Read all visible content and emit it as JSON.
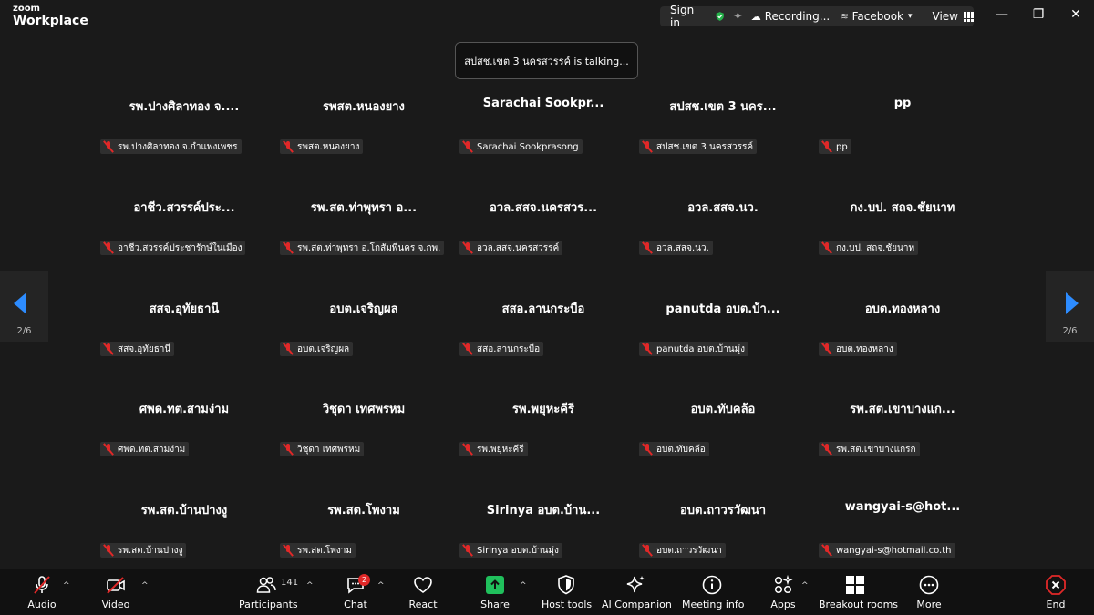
{
  "app": {
    "logo_line1": "zoom",
    "logo_line2": "Workplace"
  },
  "topbar": {
    "sign_in": "Sign in",
    "recording": "Recording...",
    "stream": "Facebook",
    "view": "View",
    "icons": [
      "shield-check-icon",
      "sparkle-icon",
      "cloud-icon",
      "wifi-icon",
      "grid-icon",
      "minimize-icon",
      "restore-icon",
      "close-icon"
    ]
  },
  "toast": "สปสช.เขต 3 นครสวรรค์ is talking...",
  "tiles": [
    {
      "big": "รพ.ปางศิลาทอง จ....",
      "tag": "รพ.ปางศิลาทอง จ.กำแพงเพชร"
    },
    {
      "big": "รพสต.หนองยาง",
      "tag": "รพสต.หนองยาง"
    },
    {
      "big": "Sarachai  Sookpr...",
      "tag": "Sarachai Sookprasong"
    },
    {
      "big": "สปสช.เขต 3 นคร...",
      "tag": "สปสช.เขต 3 นครสวรรค์"
    },
    {
      "big": "pp",
      "tag": "pp"
    },
    {
      "big": "อาชีว.สวรรค์ประ...",
      "tag": "อาชีว.สวรรค์ประชารักษ์ในเมือง"
    },
    {
      "big": "รพ.สต.ท่าพุทรา อ...",
      "tag": "รพ.สต.ท่าพุทรา อ.โกสัมพีนคร จ.กพ."
    },
    {
      "big": "อวล.สสจ.นครสวร...",
      "tag": "อวล.สสจ.นครสวรรค์"
    },
    {
      "big": "อวล.สสจ.นว.",
      "tag": "อวล.สสจ.นว."
    },
    {
      "big": "กง.บป. สถจ.ชัยนาท",
      "tag": "กง.บป. สถจ.ชัยนาท"
    },
    {
      "big": "สสจ.อุทัยธานี",
      "tag": "สสจ.อุทัยธานี"
    },
    {
      "big": "อบต.เจริญผล",
      "tag": "อบต.เจริญผล"
    },
    {
      "big": "สสอ.ลานกระบือ",
      "tag": "สสอ.ลานกระบือ"
    },
    {
      "big": "panutda อบต.บ้า...",
      "tag": "panutda อบต.บ้านมุ่ง"
    },
    {
      "big": "อบต.ทองหลาง",
      "tag": "อบต.ทองหลาง"
    },
    {
      "big": "ศพด.ทต.สามง่าม",
      "tag": "ศพด.ทต.สามง่าม"
    },
    {
      "big": "วิชุดา เทศพรหม",
      "tag": "วิชุดา เทศพรหม"
    },
    {
      "big": "รพ.พยุหะคีรี",
      "tag": "รพ.พยุหะคีรี"
    },
    {
      "big": "อบต.ทับคล้อ",
      "tag": "อบต.ทับคล้อ"
    },
    {
      "big": "รพ.สต.เขาบางแก...",
      "tag": "รพ.สต.เขาบางแกรก"
    },
    {
      "big": "รพ.สต.บ้านปางงู",
      "tag": "รพ.สต.บ้านปางงู"
    },
    {
      "big": "รพ.สต.โพงาม",
      "tag": "รพ.สต.โพงาม"
    },
    {
      "big": "Sirinya อบต.บ้าน...",
      "tag": "Sirinya อบต.บ้านมุ่ง"
    },
    {
      "big": "อบต.ถาวรวัฒนา",
      "tag": "อบต.ถาวรวัฒนา"
    },
    {
      "big": "wangyai-s@hot...",
      "tag": "wangyai-s@hotmail.co.th"
    }
  ],
  "pager": {
    "left": "2/6",
    "right": "2/6"
  },
  "toolbar": {
    "audio": "Audio",
    "video": "Video",
    "participants": "Participants",
    "participants_count": "141",
    "chat": "Chat",
    "chat_badge": "2",
    "react": "React",
    "share": "Share",
    "host_tools": "Host tools",
    "ai_companion": "AI Companion",
    "meeting_info": "Meeting info",
    "apps": "Apps",
    "breakout_rooms": "Breakout rooms",
    "more": "More",
    "end": "End"
  },
  "colors": {
    "accent_blue": "#2d8cff",
    "share_green": "#20c05c",
    "mute_red": "#e02828",
    "shield_green": "#26b34b"
  }
}
